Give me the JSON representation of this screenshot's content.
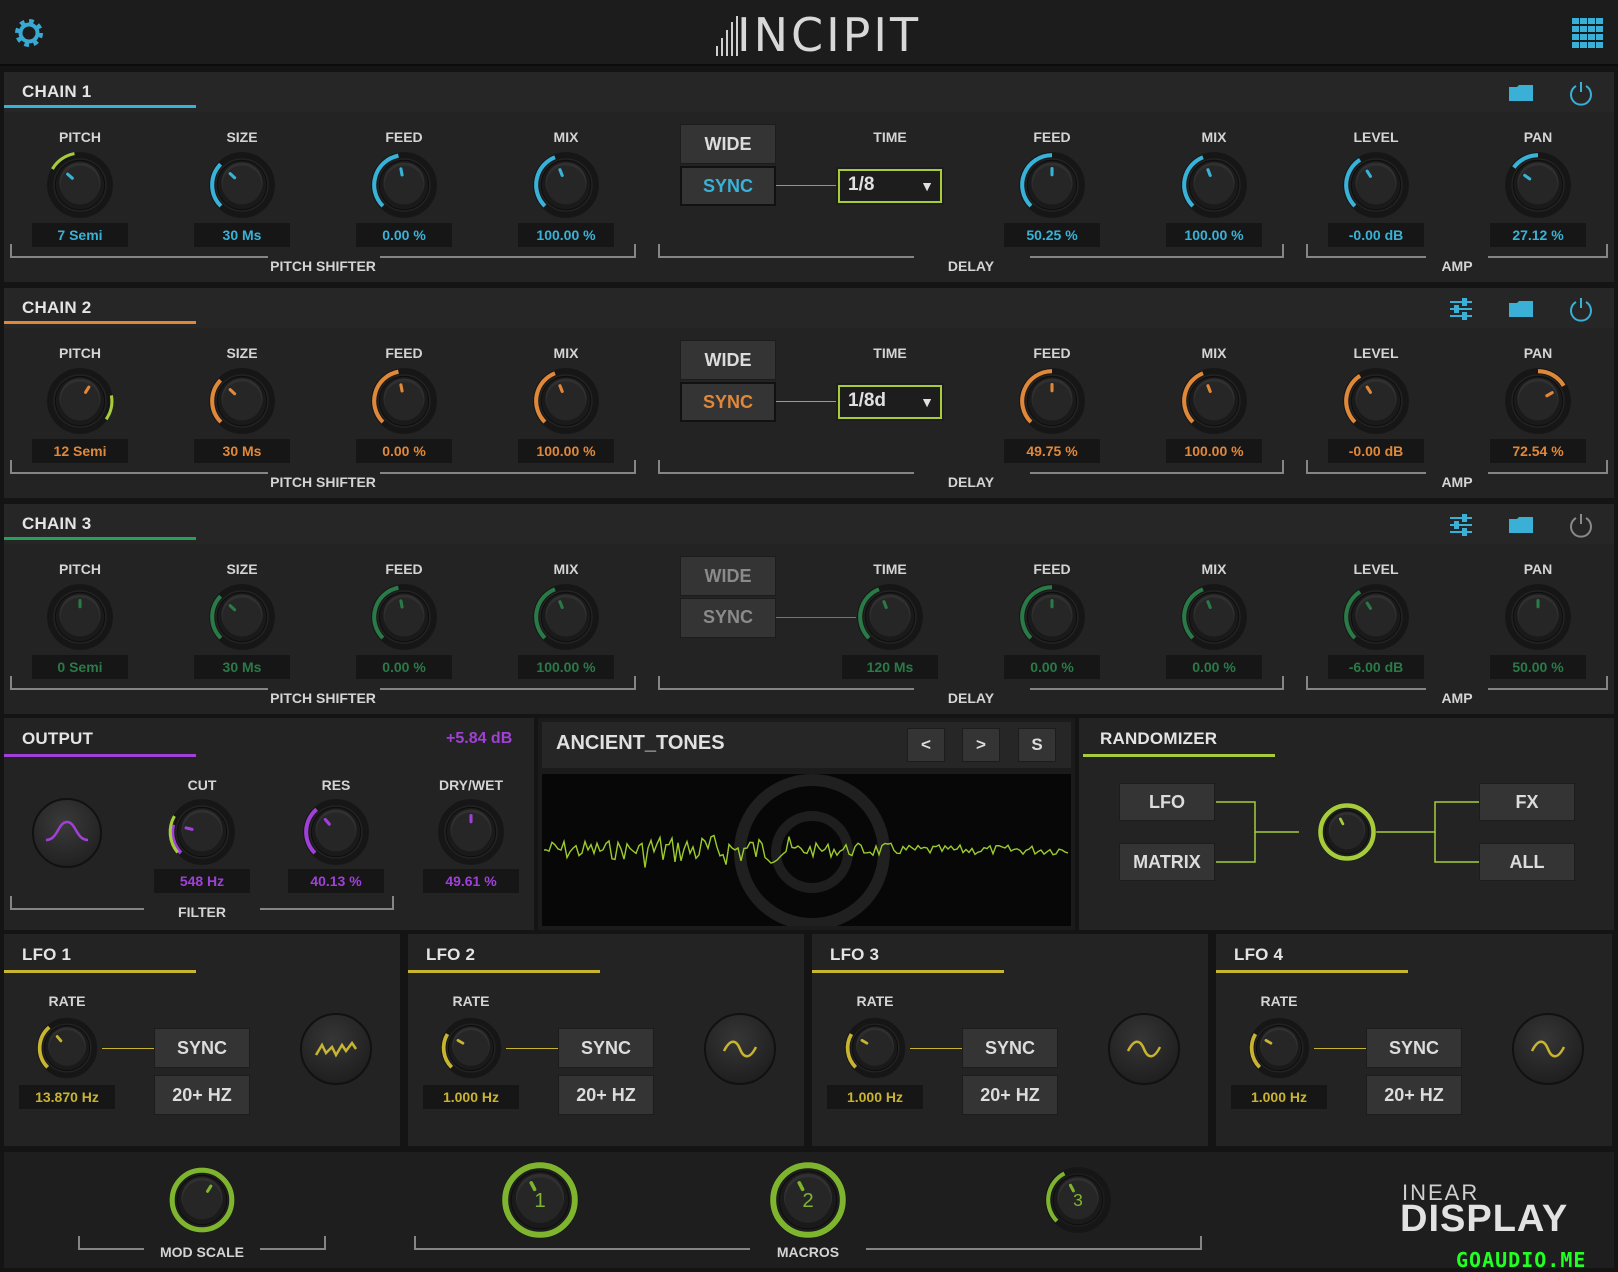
{
  "header": {
    "logo": "INCIPIT",
    "settings_icon": "gear-icon",
    "grid_icon": "grid-icon",
    "accent": "#3ab0d6"
  },
  "chains": [
    {
      "title": "CHAIN 1",
      "color": "#39b2d8",
      "active": true,
      "pitch": {
        "label": "PITCH",
        "value": "7 Semi"
      },
      "size": {
        "label": "SIZE",
        "value": "30 Ms"
      },
      "feed": {
        "label": "FEED",
        "value": "0.00 %"
      },
      "mix": {
        "label": "MIX",
        "value": "100.00 %"
      },
      "wide": "WIDE",
      "sync": "SYNC",
      "time_label": "TIME",
      "time_value": "1/8",
      "dfeed": {
        "label": "FEED",
        "value": "50.25 %"
      },
      "dmix": {
        "label": "MIX",
        "value": "100.00 %"
      },
      "level": {
        "label": "LEVEL",
        "value": "-0.00 dB"
      },
      "pan": {
        "label": "PAN",
        "value": "27.12 %"
      },
      "sec_pitch": "PITCH SHIFTER",
      "sec_delay": "DELAY",
      "sec_amp": "AMP"
    },
    {
      "title": "CHAIN 2",
      "color": "#e0883a",
      "active": true,
      "pitch": {
        "label": "PITCH",
        "value": "12 Semi"
      },
      "size": {
        "label": "SIZE",
        "value": "30 Ms"
      },
      "feed": {
        "label": "FEED",
        "value": "0.00 %"
      },
      "mix": {
        "label": "MIX",
        "value": "100.00 %"
      },
      "wide": "WIDE",
      "sync": "SYNC",
      "time_label": "TIME",
      "time_value": "1/8d",
      "dfeed": {
        "label": "FEED",
        "value": "49.75 %"
      },
      "dmix": {
        "label": "MIX",
        "value": "100.00 %"
      },
      "level": {
        "label": "LEVEL",
        "value": "-0.00 dB"
      },
      "pan": {
        "label": "PAN",
        "value": "72.54 %"
      },
      "sec_pitch": "PITCH SHIFTER",
      "sec_delay": "DELAY",
      "sec_amp": "AMP"
    },
    {
      "title": "CHAIN 3",
      "color": "#25a25a",
      "active": false,
      "pitch": {
        "label": "PITCH",
        "value": "0 Semi"
      },
      "size": {
        "label": "SIZE",
        "value": "30 Ms"
      },
      "feed": {
        "label": "FEED",
        "value": "0.00 %"
      },
      "mix": {
        "label": "MIX",
        "value": "100.00 %"
      },
      "wide": "WIDE",
      "sync": "SYNC",
      "time_label": "TIME",
      "time_value": "120 Ms",
      "dfeed": {
        "label": "FEED",
        "value": "0.00 %"
      },
      "dmix": {
        "label": "MIX",
        "value": "0.00 %"
      },
      "level": {
        "label": "LEVEL",
        "value": "-6.00 dB"
      },
      "pan": {
        "label": "PAN",
        "value": "50.00 %"
      },
      "sec_pitch": "PITCH SHIFTER",
      "sec_delay": "DELAY",
      "sec_amp": "AMP"
    }
  ],
  "output": {
    "title": "OUTPUT",
    "gain": "+5.84 dB",
    "color": "#a040d8",
    "cut": {
      "label": "CUT",
      "value": "548 Hz"
    },
    "res": {
      "label": "RES",
      "value": "40.13 %"
    },
    "drywet": {
      "label": "DRY/WET",
      "value": "49.61 %"
    },
    "section": "FILTER"
  },
  "preset": {
    "name": "ANCIENT_TONES",
    "prev": "<",
    "next": ">",
    "save": "S"
  },
  "randomizer": {
    "title": "RANDOMIZER",
    "lfo": "LFO",
    "matrix": "MATRIX",
    "fx": "FX",
    "all": "ALL",
    "color": "#a6cc3c"
  },
  "lfos": [
    {
      "title": "LFO 1",
      "rate_label": "RATE",
      "rate": "13.870 Hz",
      "sync": "SYNC",
      "range": "20+ HZ",
      "shape": "random"
    },
    {
      "title": "LFO 2",
      "rate_label": "RATE",
      "rate": "1.000 Hz",
      "sync": "SYNC",
      "range": "20+ HZ",
      "shape": "sine"
    },
    {
      "title": "LFO 3",
      "rate_label": "RATE",
      "rate": "1.000 Hz",
      "sync": "SYNC",
      "range": "20+ HZ",
      "shape": "sine"
    },
    {
      "title": "LFO 4",
      "rate_label": "RATE",
      "rate": "1.000 Hz",
      "sync": "SYNC",
      "range": "20+ HZ",
      "shape": "sine"
    }
  ],
  "lfo_color": "#c8b430",
  "footer": {
    "mod_scale": "MOD SCALE",
    "macros": "MACROS",
    "macro1": "1",
    "macro2": "2",
    "macro3": "3",
    "brand_top": "INEAR",
    "brand_bottom": "DISPLAY",
    "watermark": "GOAUDIO.ME",
    "macro_color": "#7fb52e"
  }
}
